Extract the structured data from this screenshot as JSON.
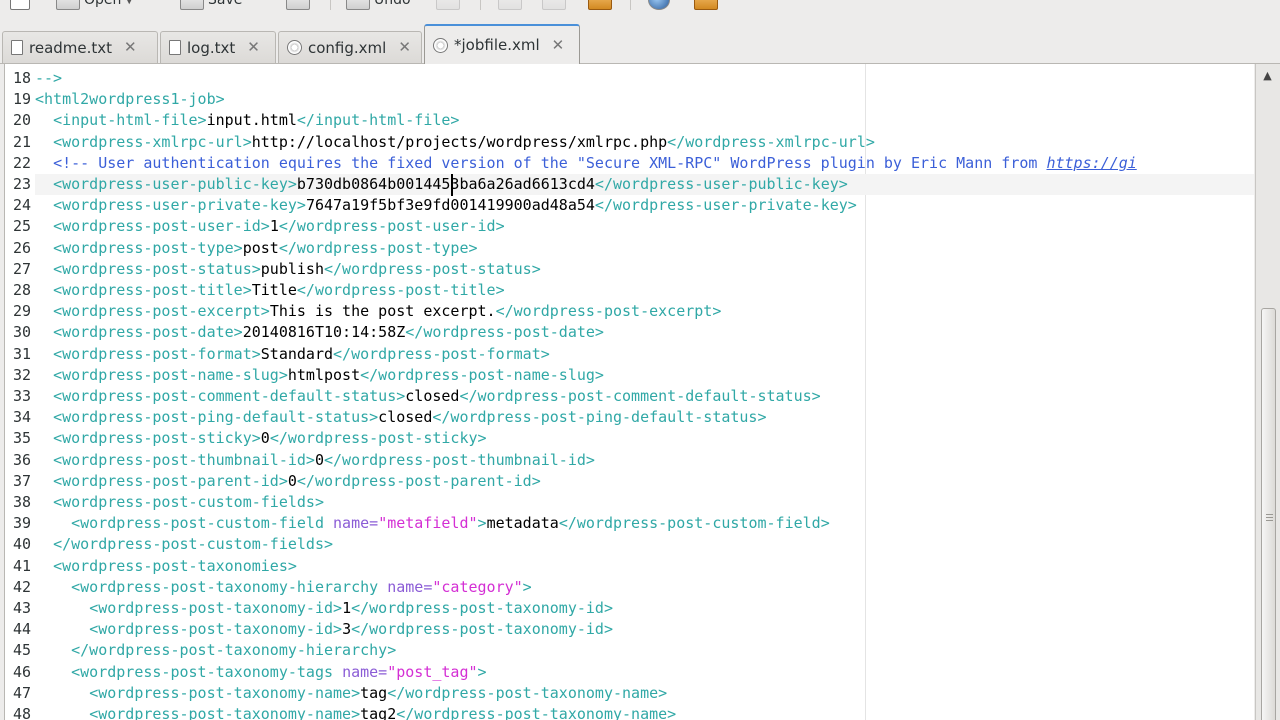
{
  "toolbar": {
    "open_label": "Open",
    "save_label": "Save",
    "undo_label": "Undo"
  },
  "tabs": [
    {
      "label": "readme.txt",
      "icon": "text-file-icon",
      "active": false
    },
    {
      "label": "log.txt",
      "icon": "text-file-icon",
      "active": false
    },
    {
      "label": "config.xml",
      "icon": "xml-file-icon",
      "active": false
    },
    {
      "label": "*jobfile.xml",
      "icon": "xml-file-icon",
      "active": true
    }
  ],
  "editor": {
    "current_line": 23,
    "colors": {
      "tag": "#30a8a6",
      "attribute": "#8b5cd6",
      "attribute_value": "#d42fd4",
      "comment": "#3b5fd8",
      "current_line_bg": "#f4f4f4"
    },
    "lines": [
      {
        "n": "18",
        "tokens": [
          [
            "tag",
            "-->"
          ]
        ]
      },
      {
        "n": "19",
        "tokens": [
          [
            "tag",
            "<html2wordpress1-job>"
          ]
        ]
      },
      {
        "n": "20",
        "tokens": [
          [
            "tok",
            "  "
          ],
          [
            "tag",
            "<input-html-file>"
          ],
          [
            "tok",
            "input.html"
          ],
          [
            "tag",
            "</input-html-file>"
          ]
        ]
      },
      {
        "n": "21",
        "tokens": [
          [
            "tok",
            "  "
          ],
          [
            "tag",
            "<wordpress-xmlrpc-url>"
          ],
          [
            "tok",
            "http://localhost/projects/wordpress/xmlrpc.php"
          ],
          [
            "tag",
            "</wordpress-xmlrpc-url>"
          ]
        ]
      },
      {
        "n": "22",
        "tokens": [
          [
            "tok",
            "  "
          ],
          [
            "cmt",
            "<!-- User authentication equires the fixed version of the \"Secure XML-RPC\" WordPress plugin by Eric Mann from "
          ],
          [
            "link",
            "https://gi"
          ]
        ]
      },
      {
        "n": "23",
        "tokens": [
          [
            "tok",
            "  "
          ],
          [
            "tag",
            "<wordpress-user-public-key>"
          ],
          [
            "tok",
            "b730db0864b0014453ba6a26ad6613cd4"
          ],
          [
            "tag",
            "</wordpress-user-public-key>"
          ]
        ]
      },
      {
        "n": "24",
        "tokens": [
          [
            "tok",
            "  "
          ],
          [
            "tag",
            "<wordpress-user-private-key>"
          ],
          [
            "tok",
            "7647a19f5bf3e9fd001419900ad48a54"
          ],
          [
            "tag",
            "</wordpress-user-private-key>"
          ]
        ]
      },
      {
        "n": "25",
        "tokens": [
          [
            "tok",
            "  "
          ],
          [
            "tag",
            "<wordpress-post-user-id>"
          ],
          [
            "tok",
            "1"
          ],
          [
            "tag",
            "</wordpress-post-user-id>"
          ]
        ]
      },
      {
        "n": "26",
        "tokens": [
          [
            "tok",
            "  "
          ],
          [
            "tag",
            "<wordpress-post-type>"
          ],
          [
            "tok",
            "post"
          ],
          [
            "tag",
            "</wordpress-post-type>"
          ]
        ]
      },
      {
        "n": "27",
        "tokens": [
          [
            "tok",
            "  "
          ],
          [
            "tag",
            "<wordpress-post-status>"
          ],
          [
            "tok",
            "publish"
          ],
          [
            "tag",
            "</wordpress-post-status>"
          ]
        ]
      },
      {
        "n": "28",
        "tokens": [
          [
            "tok",
            "  "
          ],
          [
            "tag",
            "<wordpress-post-title>"
          ],
          [
            "tok",
            "Title"
          ],
          [
            "tag",
            "</wordpress-post-title>"
          ]
        ]
      },
      {
        "n": "29",
        "tokens": [
          [
            "tok",
            "  "
          ],
          [
            "tag",
            "<wordpress-post-excerpt>"
          ],
          [
            "tok",
            "This is the post excerpt."
          ],
          [
            "tag",
            "</wordpress-post-excerpt>"
          ]
        ]
      },
      {
        "n": "30",
        "tokens": [
          [
            "tok",
            "  "
          ],
          [
            "tag",
            "<wordpress-post-date>"
          ],
          [
            "tok",
            "20140816T10:14:58Z"
          ],
          [
            "tag",
            "</wordpress-post-date>"
          ]
        ]
      },
      {
        "n": "31",
        "tokens": [
          [
            "tok",
            "  "
          ],
          [
            "tag",
            "<wordpress-post-format>"
          ],
          [
            "tok",
            "Standard"
          ],
          [
            "tag",
            "</wordpress-post-format>"
          ]
        ]
      },
      {
        "n": "32",
        "tokens": [
          [
            "tok",
            "  "
          ],
          [
            "tag",
            "<wordpress-post-name-slug>"
          ],
          [
            "tok",
            "htmlpost"
          ],
          [
            "tag",
            "</wordpress-post-name-slug>"
          ]
        ]
      },
      {
        "n": "33",
        "tokens": [
          [
            "tok",
            "  "
          ],
          [
            "tag",
            "<wordpress-post-comment-default-status>"
          ],
          [
            "tok",
            "closed"
          ],
          [
            "tag",
            "</wordpress-post-comment-default-status>"
          ]
        ]
      },
      {
        "n": "34",
        "tokens": [
          [
            "tok",
            "  "
          ],
          [
            "tag",
            "<wordpress-post-ping-default-status>"
          ],
          [
            "tok",
            "closed"
          ],
          [
            "tag",
            "</wordpress-post-ping-default-status>"
          ]
        ]
      },
      {
        "n": "35",
        "tokens": [
          [
            "tok",
            "  "
          ],
          [
            "tag",
            "<wordpress-post-sticky>"
          ],
          [
            "tok",
            "0"
          ],
          [
            "tag",
            "</wordpress-post-sticky>"
          ]
        ]
      },
      {
        "n": "36",
        "tokens": [
          [
            "tok",
            "  "
          ],
          [
            "tag",
            "<wordpress-post-thumbnail-id>"
          ],
          [
            "tok",
            "0"
          ],
          [
            "tag",
            "</wordpress-post-thumbnail-id>"
          ]
        ]
      },
      {
        "n": "37",
        "tokens": [
          [
            "tok",
            "  "
          ],
          [
            "tag",
            "<wordpress-post-parent-id>"
          ],
          [
            "tok",
            "0"
          ],
          [
            "tag",
            "</wordpress-post-parent-id>"
          ]
        ]
      },
      {
        "n": "38",
        "tokens": [
          [
            "tok",
            "  "
          ],
          [
            "tag",
            "<wordpress-post-custom-fields>"
          ]
        ]
      },
      {
        "n": "39",
        "tokens": [
          [
            "tok",
            "    "
          ],
          [
            "tag",
            "<wordpress-post-custom-field "
          ],
          [
            "attr",
            "name="
          ],
          [
            "val",
            "\"metafield\""
          ],
          [
            "tag",
            ">"
          ],
          [
            "tok",
            "metadata"
          ],
          [
            "tag",
            "</wordpress-post-custom-field>"
          ]
        ]
      },
      {
        "n": "40",
        "tokens": [
          [
            "tok",
            "  "
          ],
          [
            "tag",
            "</wordpress-post-custom-fields>"
          ]
        ]
      },
      {
        "n": "41",
        "tokens": [
          [
            "tok",
            "  "
          ],
          [
            "tag",
            "<wordpress-post-taxonomies>"
          ]
        ]
      },
      {
        "n": "42",
        "tokens": [
          [
            "tok",
            "    "
          ],
          [
            "tag",
            "<wordpress-post-taxonomy-hierarchy "
          ],
          [
            "attr",
            "name="
          ],
          [
            "val",
            "\"category\""
          ],
          [
            "tag",
            ">"
          ]
        ]
      },
      {
        "n": "43",
        "tokens": [
          [
            "tok",
            "      "
          ],
          [
            "tag",
            "<wordpress-post-taxonomy-id>"
          ],
          [
            "tok",
            "1"
          ],
          [
            "tag",
            "</wordpress-post-taxonomy-id>"
          ]
        ]
      },
      {
        "n": "44",
        "tokens": [
          [
            "tok",
            "      "
          ],
          [
            "tag",
            "<wordpress-post-taxonomy-id>"
          ],
          [
            "tok",
            "3"
          ],
          [
            "tag",
            "</wordpress-post-taxonomy-id>"
          ]
        ]
      },
      {
        "n": "45",
        "tokens": [
          [
            "tok",
            "    "
          ],
          [
            "tag",
            "</wordpress-post-taxonomy-hierarchy>"
          ]
        ]
      },
      {
        "n": "46",
        "tokens": [
          [
            "tok",
            "    "
          ],
          [
            "tag",
            "<wordpress-post-taxonomy-tags "
          ],
          [
            "attr",
            "name="
          ],
          [
            "val",
            "\"post_tag\""
          ],
          [
            "tag",
            ">"
          ]
        ]
      },
      {
        "n": "47",
        "tokens": [
          [
            "tok",
            "      "
          ],
          [
            "tag",
            "<wordpress-post-taxonomy-name>"
          ],
          [
            "tok",
            "tag"
          ],
          [
            "tag",
            "</wordpress-post-taxonomy-name>"
          ]
        ]
      },
      {
        "n": "48",
        "tokens": [
          [
            "tok",
            "      "
          ],
          [
            "tag",
            "<wordpress-post-taxonomy-name>"
          ],
          [
            "tok",
            "tag2"
          ],
          [
            "tag",
            "</wordpress-post-taxonomy-name>"
          ]
        ]
      }
    ]
  }
}
